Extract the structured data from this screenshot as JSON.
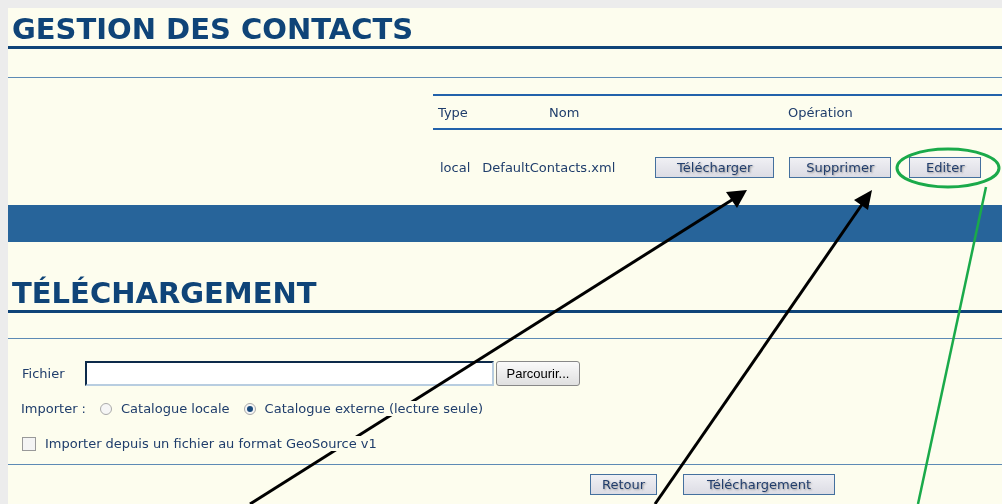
{
  "contacts": {
    "title": "GESTION DES CONTACTS",
    "columns": [
      "Type",
      "Nom",
      "Opération"
    ],
    "rows": [
      {
        "type": "local",
        "name": "DefaultContacts.xml",
        "buttons": [
          "Télécharger",
          "Supprimer",
          "Editer"
        ]
      }
    ]
  },
  "upload": {
    "title": "TÉLÉCHARGEMENT",
    "file": {
      "label": "Fichier",
      "browse_button": "Parcourir..."
    },
    "import": {
      "label": "Importer :",
      "options": [
        {
          "label": "Catalogue locale",
          "selected": false
        },
        {
          "label": "Catalogue externe (lecture seule)",
          "selected": true
        }
      ]
    },
    "geosource": {
      "label": "Importer depuis un fichier au format GeoSource v1",
      "checked": false
    },
    "buttons": [
      "Retour",
      "Téléchargement"
    ]
  }
}
